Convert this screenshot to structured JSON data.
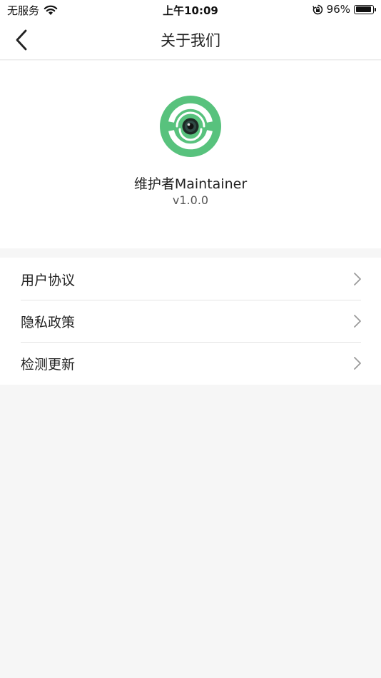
{
  "status_bar": {
    "carrier": "无服务",
    "time": "上午10:09",
    "battery_percent": "96%",
    "battery_level": 0.96,
    "icons": [
      "wifi-icon",
      "rotation-lock-icon",
      "battery-icon"
    ]
  },
  "nav": {
    "title": "关于我们",
    "back_icon": "chevron-left-icon"
  },
  "app": {
    "name": "维护者Maintainer",
    "version": "v1.0.0",
    "logo_color": "#58c27d"
  },
  "menu": {
    "items": [
      {
        "label": "用户协议",
        "icon": "chevron-right-icon"
      },
      {
        "label": "隐私政策",
        "icon": "chevron-right-icon"
      },
      {
        "label": "检测更新",
        "icon": "chevron-right-icon"
      }
    ]
  },
  "colors": {
    "background": "#f6f6f6",
    "surface": "#ffffff",
    "divider": "#e3e3e3",
    "brand_green": "#58c27d"
  }
}
